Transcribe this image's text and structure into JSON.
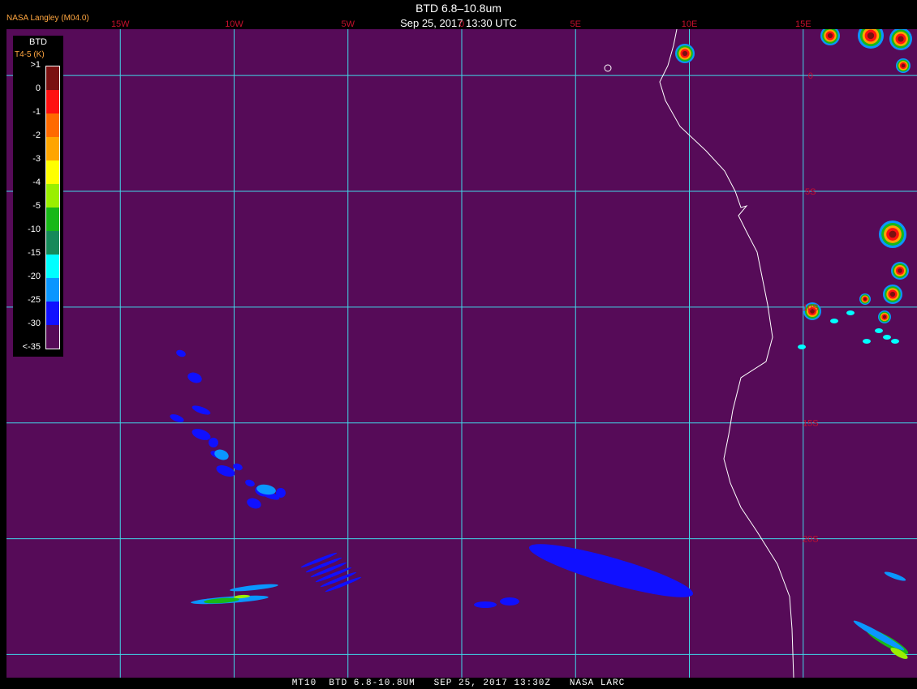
{
  "header": {
    "credit": "NASA Langley (M04.0)",
    "title": "BTD 6.8–10.8um",
    "datetime": "Sep 25, 2017 13:30 UTC"
  },
  "footer": {
    "text": "MT10  BTD 6.8-10.8UM   SEP 25, 2017 13:30Z   NASA LARC"
  },
  "legend": {
    "title": "BTD",
    "unit": "T4-5 (K)",
    "labels": [
      ">1",
      "0",
      "-1",
      "-2",
      "-3",
      "-4",
      "-5",
      "-10",
      "-15",
      "-20",
      "-25",
      "-30",
      "<-35"
    ],
    "colors": [
      "#7a1010",
      "#ff1010",
      "#ff6a00",
      "#ffa500",
      "#ffff00",
      "#9aef00",
      "#18b818",
      "#168a5a",
      "#00ffff",
      "#0a96ff",
      "#1010ff",
      "#560b58"
    ]
  },
  "map": {
    "background_color": "#560b58",
    "grid_color": "#40d8e8",
    "coast_color": "#ffffff",
    "lon_labels": [
      "15W",
      "10W",
      "5W",
      "0",
      "5E",
      "10E",
      "15E"
    ],
    "lat_labels": [
      "0",
      "5S",
      "10S",
      "15S",
      "20S"
    ],
    "lon_range": [
      -20,
      20
    ],
    "lat_range": [
      2,
      -26
    ]
  }
}
